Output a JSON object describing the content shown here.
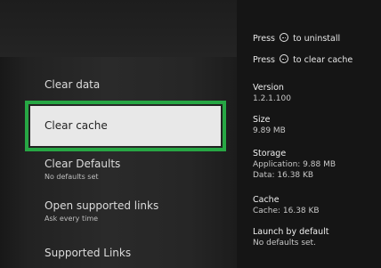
{
  "menu": {
    "clear_data": {
      "title": "Clear data"
    },
    "clear_cache": {
      "title": "Clear cache"
    },
    "clear_defaults": {
      "title": "Clear Defaults",
      "subtitle": "No defaults set"
    },
    "open_supported_links": {
      "title": "Open supported links",
      "subtitle": "Ask every time"
    },
    "supported_links": {
      "title": "Supported Links"
    }
  },
  "hints": {
    "uninstall": {
      "pre": "Press",
      "icon": "menu-button-icon",
      "post": "to uninstall"
    },
    "clear_cache": {
      "pre": "Press",
      "icon": "menu-button-icon",
      "post": "to clear cache"
    }
  },
  "info": {
    "version": {
      "label": "Version",
      "value": "1.2.1.100"
    },
    "size": {
      "label": "Size",
      "value": "9.89 MB"
    },
    "storage": {
      "label": "Storage",
      "application": "Application: 9.88 MB",
      "data": "Data: 16.38 KB"
    },
    "cache": {
      "label": "Cache",
      "value": "Cache: 16.38 KB"
    },
    "launch_by_default": {
      "label": "Launch by default",
      "value": "No defaults set."
    }
  },
  "colors": {
    "focus_border": "#27a744",
    "focus_fill": "#e8e8e8",
    "background_dark": "#151515"
  }
}
